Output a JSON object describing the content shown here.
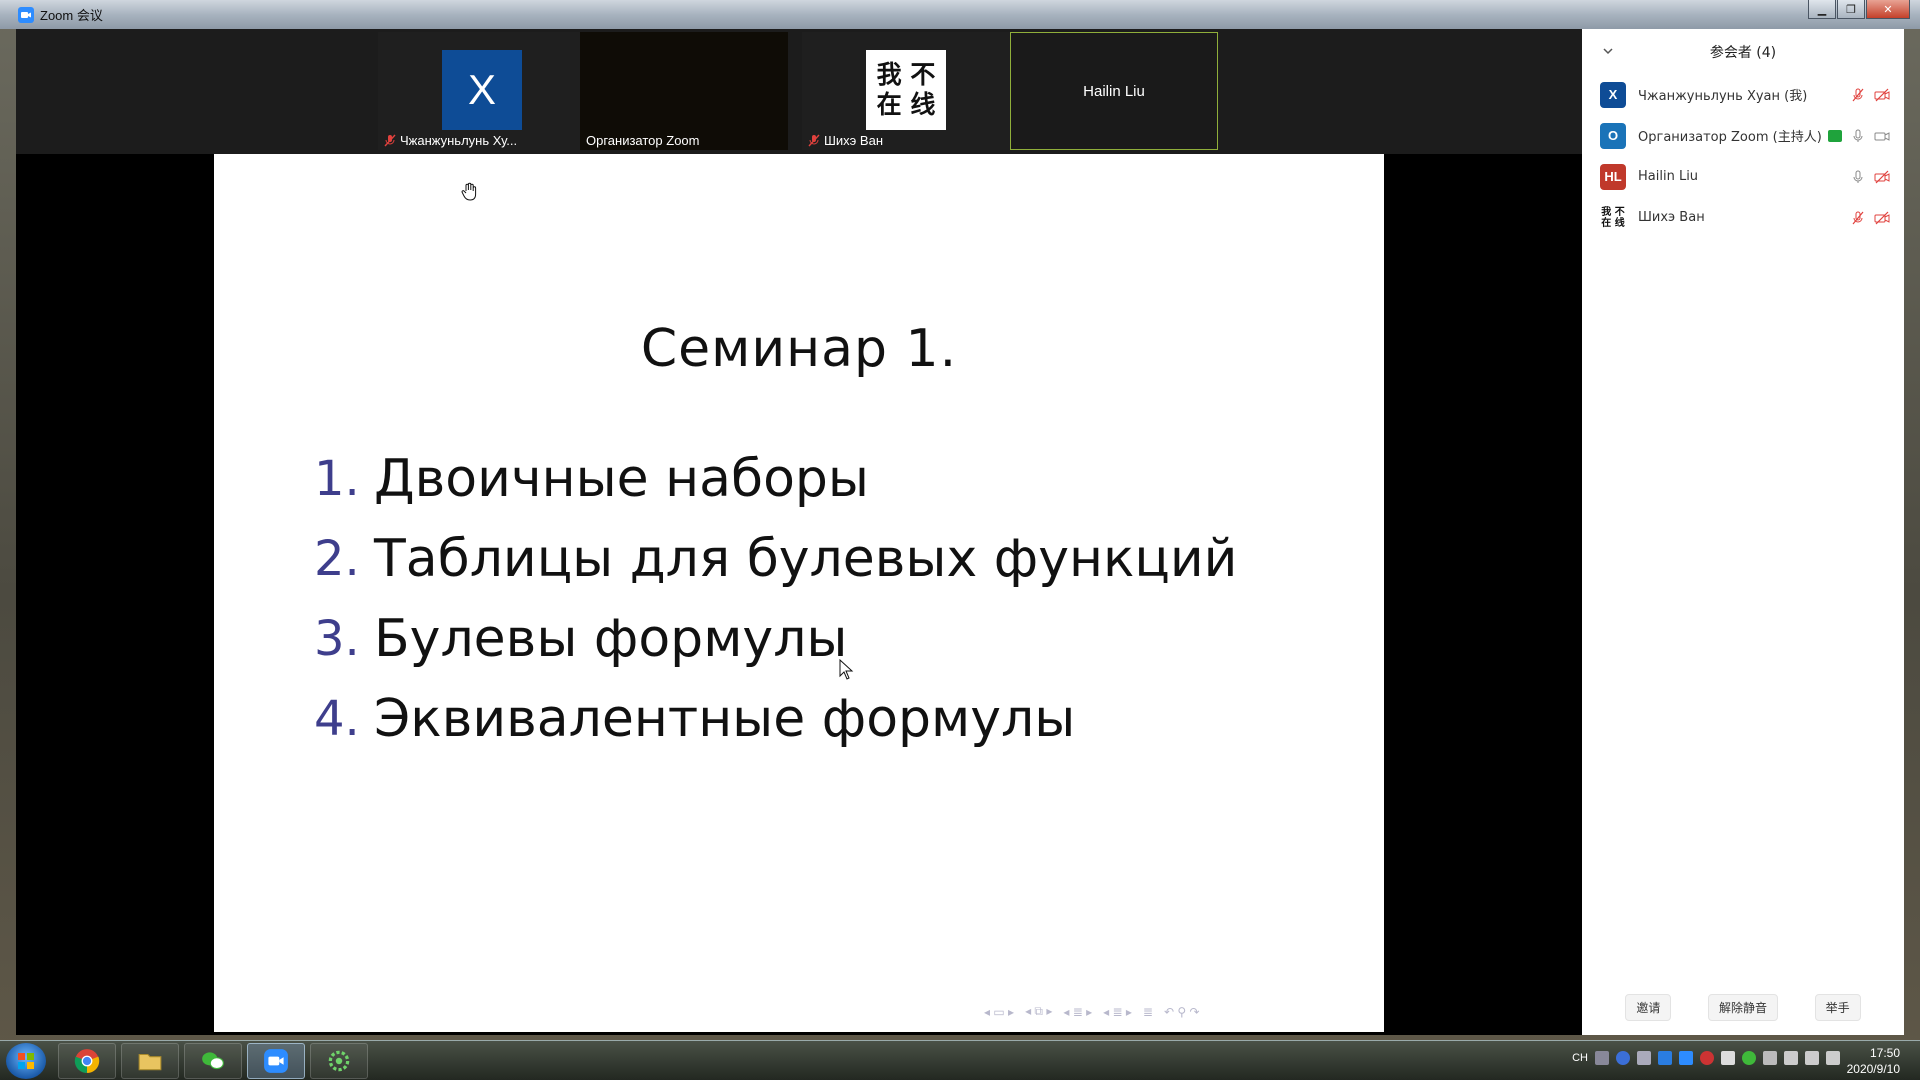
{
  "window": {
    "title": "Zoom 会议",
    "minimize": "▁",
    "restore": "❐",
    "close": "✕"
  },
  "gallery": {
    "tiles": [
      {
        "name": "Чжанжуньлунь Ху...",
        "avatar": "X",
        "muted": true
      },
      {
        "name": "Организатор Zoom",
        "muted": false
      },
      {
        "name": "Шихэ Ван",
        "avatar": "我 不 在 线",
        "muted": true
      },
      {
        "name": "Hailin Liu",
        "active_speaker": true
      }
    ]
  },
  "slide": {
    "title": "Семинар 1.",
    "items": [
      {
        "num": "1.",
        "text": "Двоичные наборы"
      },
      {
        "num": "2.",
        "text": "Таблицы для булевых функций"
      },
      {
        "num": "3.",
        "text": "Булевы формулы"
      },
      {
        "num": "4.",
        "text": "Эквивалентные формулы"
      }
    ]
  },
  "participants": {
    "title": "参会者 (4)",
    "list": [
      {
        "initials": "X",
        "color": "#0e4c96",
        "name": "Чжанжуньлунь Хуан (我)",
        "audio": "muted",
        "video": "off"
      },
      {
        "initials": "O",
        "color": "#1a73b8",
        "name": "Организатор Zoom (主持人)",
        "sharing": true,
        "audio": "on",
        "video": "on"
      },
      {
        "initials": "HL",
        "color": "#c0392b",
        "name": "Hailin Liu",
        "audio": "on",
        "video": "off"
      },
      {
        "initials": "我 不 在 线",
        "color": "#ffffff",
        "name": "Шихэ Ван",
        "audio": "muted",
        "video": "off"
      }
    ],
    "buttons": {
      "invite": "邀请",
      "unmute_me": "解除静音",
      "raise_hand": "举手"
    }
  },
  "taskbar": {
    "tray_lang": "CH",
    "time": "17:50",
    "date": "2020/9/10"
  },
  "colors": {
    "zoom_blue": "#2d8cff",
    "active_speaker_border": "#8fae3a",
    "muted_red": "#e0413d"
  }
}
